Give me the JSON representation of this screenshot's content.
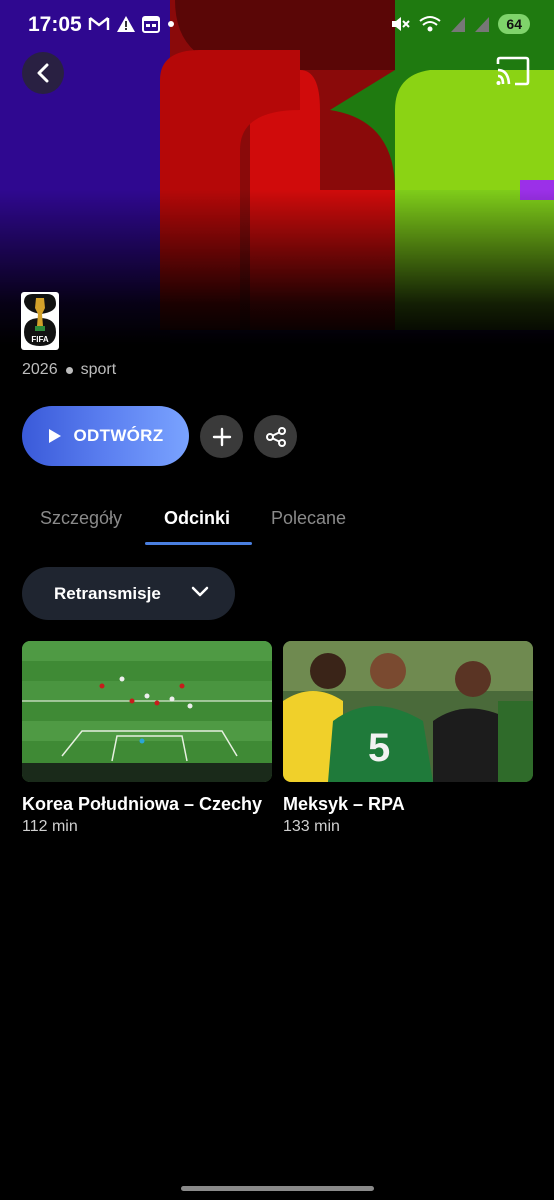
{
  "status_bar": {
    "time": "17:05",
    "battery": "64"
  },
  "hero": {
    "colors": {
      "purple": "#4a0fb0",
      "red": "#d10a0a",
      "green": "#8fdc14"
    }
  },
  "show": {
    "year": "2026",
    "genre": "sport",
    "logo_text": "FIFA"
  },
  "actions": {
    "play_label": "ODTWÓRZ"
  },
  "tabs": [
    {
      "label": "Szczegóły",
      "active": false
    },
    {
      "label": "Odcinki",
      "active": true
    },
    {
      "label": "Polecane",
      "active": false
    }
  ],
  "filter": {
    "selected": "Retransmisje"
  },
  "episodes": [
    {
      "title": "Korea Południowa – Czechy",
      "duration": "112 min"
    },
    {
      "title": "Meksyk – RPA",
      "duration": "133 min"
    }
  ],
  "icons": {
    "back": "chevron-left-icon",
    "cast": "cast-icon",
    "add": "plus-icon",
    "share": "share-icon",
    "play": "play-icon",
    "dropdown": "chevron-down-icon"
  },
  "accent_color": "#4a7fe0"
}
